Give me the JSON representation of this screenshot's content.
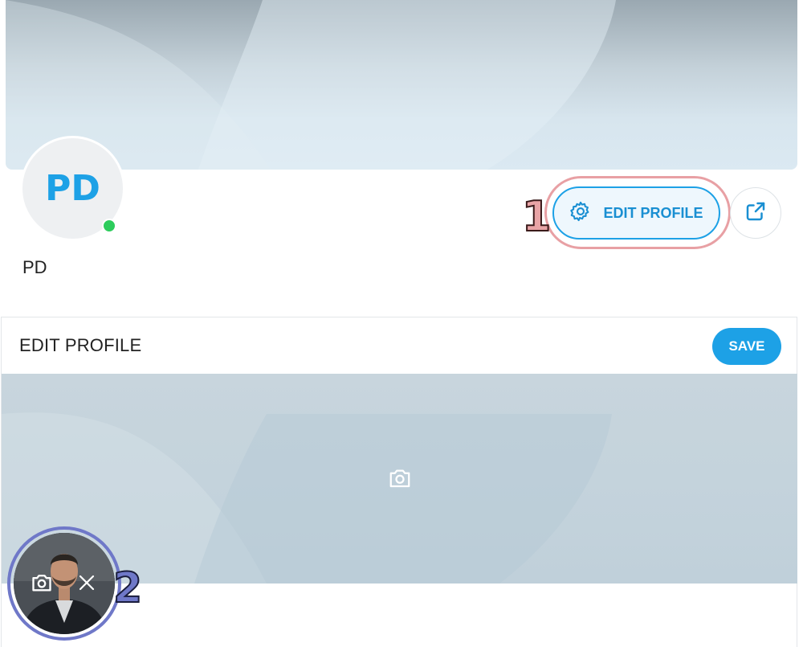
{
  "profile": {
    "initials": "PD",
    "name": "PD",
    "status": "online",
    "edit_button_label": "EDIT PROFILE"
  },
  "edit_panel": {
    "title": "EDIT PROFILE",
    "save_label": "SAVE"
  },
  "annotations": {
    "one": "1",
    "two": "2"
  },
  "icons": {
    "edit": "gear-icon",
    "share": "share-icon",
    "cover_upload": "camera-icon",
    "avatar_upload": "camera-icon",
    "avatar_remove": "close-icon"
  },
  "colors": {
    "accent": "#1da1e6",
    "online": "#2dcc5c",
    "annotation_1": "#e9a4a6",
    "annotation_2": "#6f78c8"
  }
}
